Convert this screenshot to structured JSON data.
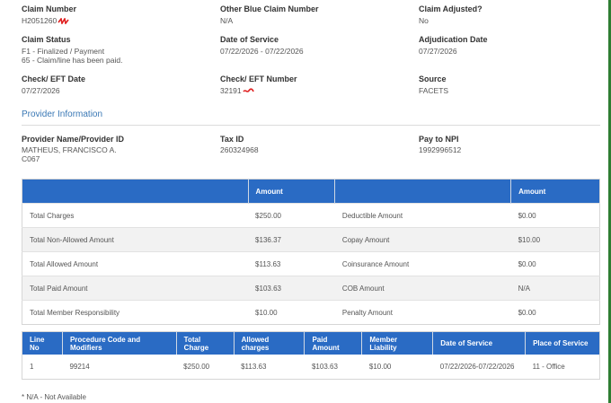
{
  "claim": {
    "claim_number_label": "Claim Number",
    "claim_number_value": "H2051260",
    "other_blue_label": "Other Blue Claim Number",
    "other_blue_value": "N/A",
    "claim_adjusted_label": "Claim Adjusted?",
    "claim_adjusted_value": "No",
    "claim_status_label": "Claim Status",
    "claim_status_line1": "F1 - Finalized / Payment",
    "claim_status_line2": "65 - Claim/line has been paid.",
    "date_of_service_label": "Date of Service",
    "date_of_service_value": "07/22/2026 - 07/22/2026",
    "adjudication_date_label": "Adjudication Date",
    "adjudication_date_value": "07/27/2026",
    "check_eft_date_label": "Check/ EFT Date",
    "check_eft_date_value": "07/27/2026",
    "check_eft_number_label": "Check/ EFT Number",
    "check_eft_number_value": "32191",
    "source_label": "Source",
    "source_value": "FACETS"
  },
  "provider": {
    "section_title": "Provider Information",
    "name_label": "Provider Name/Provider ID",
    "name_line1": "MATHEUS, FRANCISCO A.",
    "name_line2": "C067",
    "tax_id_label": "Tax ID",
    "tax_id_value": "260324968",
    "pay_to_npi_label": "Pay to NPI",
    "pay_to_npi_value": "1992996512"
  },
  "amounts_table": {
    "header_amount_left": "Amount",
    "header_amount_right": "Amount",
    "rows": [
      {
        "label": "Total Charges",
        "amount": "$250.00",
        "label2": "Deductible Amount",
        "amount2": "$0.00"
      },
      {
        "label": "Total Non-Allowed Amount",
        "amount": "$136.37",
        "label2": "Copay Amount",
        "amount2": "$10.00"
      },
      {
        "label": "Total Allowed Amount",
        "amount": "$113.63",
        "label2": "Coinsurance Amount",
        "amount2": "$0.00"
      },
      {
        "label": "Total Paid Amount",
        "amount": "$103.63",
        "label2": "COB Amount",
        "amount2": "N/A"
      },
      {
        "label": "Total Member Responsibility",
        "amount": "$10.00",
        "label2": "Penalty Amount",
        "amount2": "$0.00"
      }
    ]
  },
  "lines_table": {
    "headers": [
      "Line No",
      "Procedure Code and Modifiers",
      "Total Charge",
      "Allowed charges",
      "Paid Amount",
      "Member Liability",
      "Date of Service",
      "Place of Service"
    ],
    "rows": [
      [
        "1",
        "99214",
        "$250.00",
        "$113.63",
        "$103.63",
        "$10.00",
        "07/22/2026-07/22/2026",
        "11 - Office"
      ]
    ]
  },
  "footnote": "* N/A - Not Available",
  "colors": {
    "header_blue": "#2a6bc4",
    "link_blue": "#3a78b5",
    "redaction_red": "#e02020"
  }
}
